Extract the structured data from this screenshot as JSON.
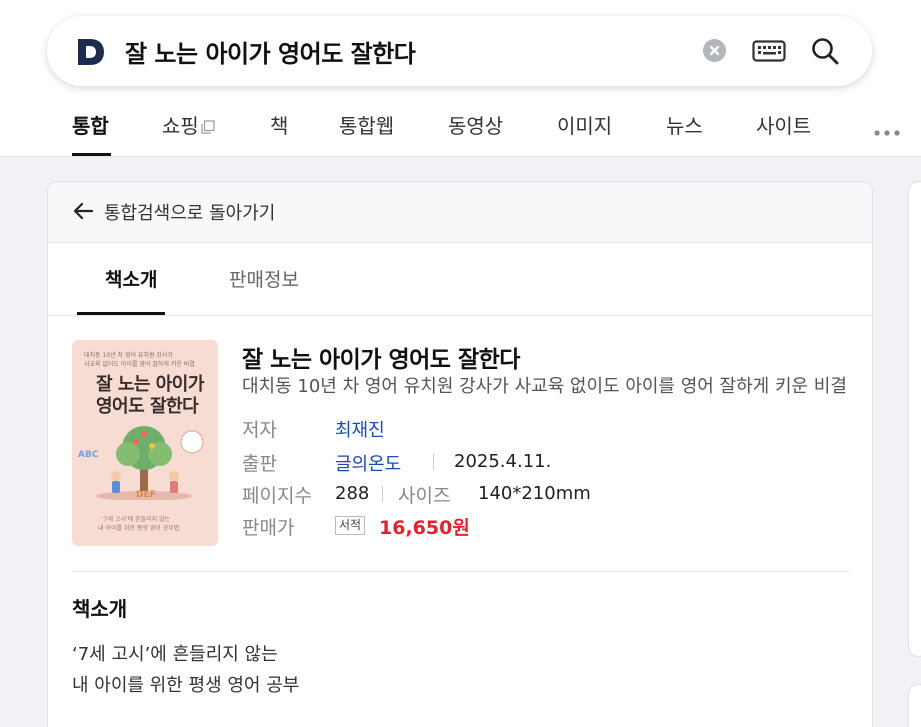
{
  "search": {
    "query": "잘 노는 아이가 영어도 잘한다",
    "logo_icon": "daum-d-logo",
    "clear_icon": "clear-icon",
    "keyboard_icon": "keyboard-icon",
    "search_icon": "search-icon"
  },
  "tabs": [
    {
      "label": "통합",
      "active": true
    },
    {
      "label": "쇼핑",
      "active": false
    },
    {
      "label": "책",
      "active": false
    },
    {
      "label": "통합웹",
      "active": false
    },
    {
      "label": "동영상",
      "active": false
    },
    {
      "label": "이미지",
      "active": false
    },
    {
      "label": "뉴스",
      "active": false
    },
    {
      "label": "사이트",
      "active": false
    }
  ],
  "back": {
    "label": "통합검색으로 돌아가기"
  },
  "subtabs": [
    {
      "label": "책소개",
      "active": true
    },
    {
      "label": "판매정보",
      "active": false
    }
  ],
  "cover": {
    "tagline_1": "대치동 10년 차 영어 유치원 강사가",
    "tagline_2": "사교육 없이도 아이를 영어 잘하게 키운 비결",
    "title_1": "잘 노는 아이가",
    "title_2": "영어도 잘한다",
    "bottom_1": "'7세 고시'에 흔들리지 않는",
    "bottom_2": "내 아이를 위한 평생 영어 공부법",
    "letters_1": "ABC",
    "letters_2": "DEF"
  },
  "book": {
    "title": "잘 노는 아이가 영어도 잘한다",
    "subtitle": "대치동 10년 차 영어 유치원 강사가 사교육 없이도 아이를 영어 잘하게 키운 비결",
    "author_label": "저자",
    "author": "최재진",
    "publisher_label": "출판",
    "publisher": "글의온도",
    "date": "2025.4.11.",
    "pages_label": "페이지수",
    "pages": "288",
    "size_label": "사이즈",
    "size": "140*210mm",
    "price_label": "판매가",
    "store_badge": "서적",
    "price": "16,650원"
  },
  "intro": {
    "heading": "책소개",
    "line_1": "‘7세 고시’에 흔들리지 않는",
    "line_2": "내 아이를 위한 평생 영어 공부"
  }
}
